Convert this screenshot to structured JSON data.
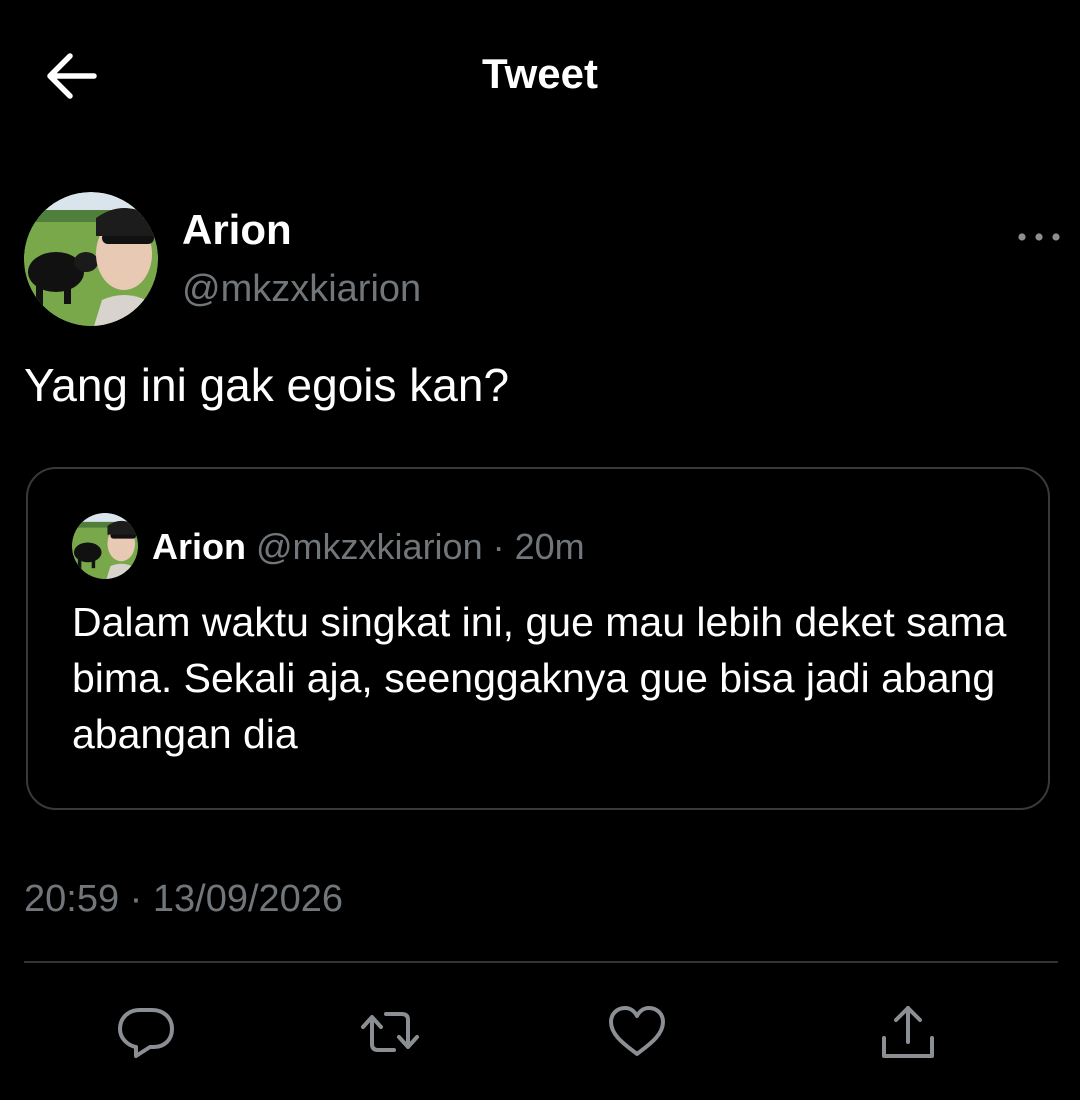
{
  "header": {
    "title": "Tweet",
    "back_icon": "arrow-left-icon"
  },
  "tweet": {
    "author": {
      "name": "Arion",
      "handle": "@mkzxkiarion"
    },
    "text": "Yang ini gak egois kan?",
    "timestamp": "20:59 · 13/09/2026",
    "more_icon": "more-horizontal-icon"
  },
  "quoted_tweet": {
    "name": "Arion",
    "handle": "@mkzxkiarion",
    "separator": "·",
    "time": "20m",
    "text": "Dalam waktu singkat ini, gue mau lebih deket sama bima. Sekali aja, seenggaknya gue bisa jadi abang abangan dia"
  },
  "actions": {
    "reply_icon": "reply-icon",
    "retweet_icon": "retweet-icon",
    "like_icon": "heart-icon",
    "share_icon": "share-icon"
  },
  "colors": {
    "background": "#000000",
    "primary_text": "#ffffff",
    "secondary_text": "#71767b",
    "border": "#38393d"
  }
}
